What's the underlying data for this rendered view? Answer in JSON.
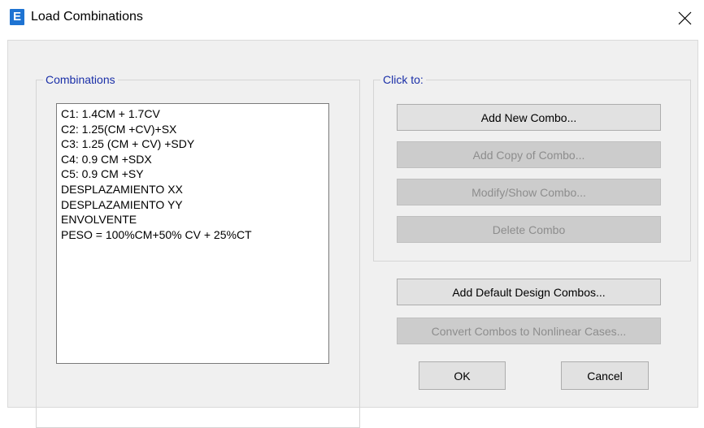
{
  "window": {
    "title": "Load Combinations",
    "app_icon_letter": "E"
  },
  "combinations": {
    "group_label": "Combinations",
    "items": [
      "C1: 1.4CM + 1.7CV",
      "C2: 1.25(CM +CV)+SX",
      "C3: 1.25 (CM + CV) +SDY",
      "C4: 0.9 CM +SDX",
      "C5: 0.9 CM +SY",
      "DESPLAZAMIENTO XX",
      "DESPLAZAMIENTO YY",
      "ENVOLVENTE",
      "PESO = 100%CM+50% CV + 25%CT"
    ]
  },
  "click_to": {
    "group_label": "Click to:",
    "add_new": "Add New Combo...",
    "add_copy": "Add Copy of Combo...",
    "modify_show": "Modify/Show Combo...",
    "delete": "Delete Combo"
  },
  "buttons": {
    "add_default": "Add Default Design Combos...",
    "convert": "Convert Combos to Nonlinear Cases...",
    "ok": "OK",
    "cancel": "Cancel"
  },
  "colors": {
    "group_label": "#1a2fa8",
    "app_icon": "#1e73d2",
    "dialog_bg": "#f0f0f0"
  }
}
